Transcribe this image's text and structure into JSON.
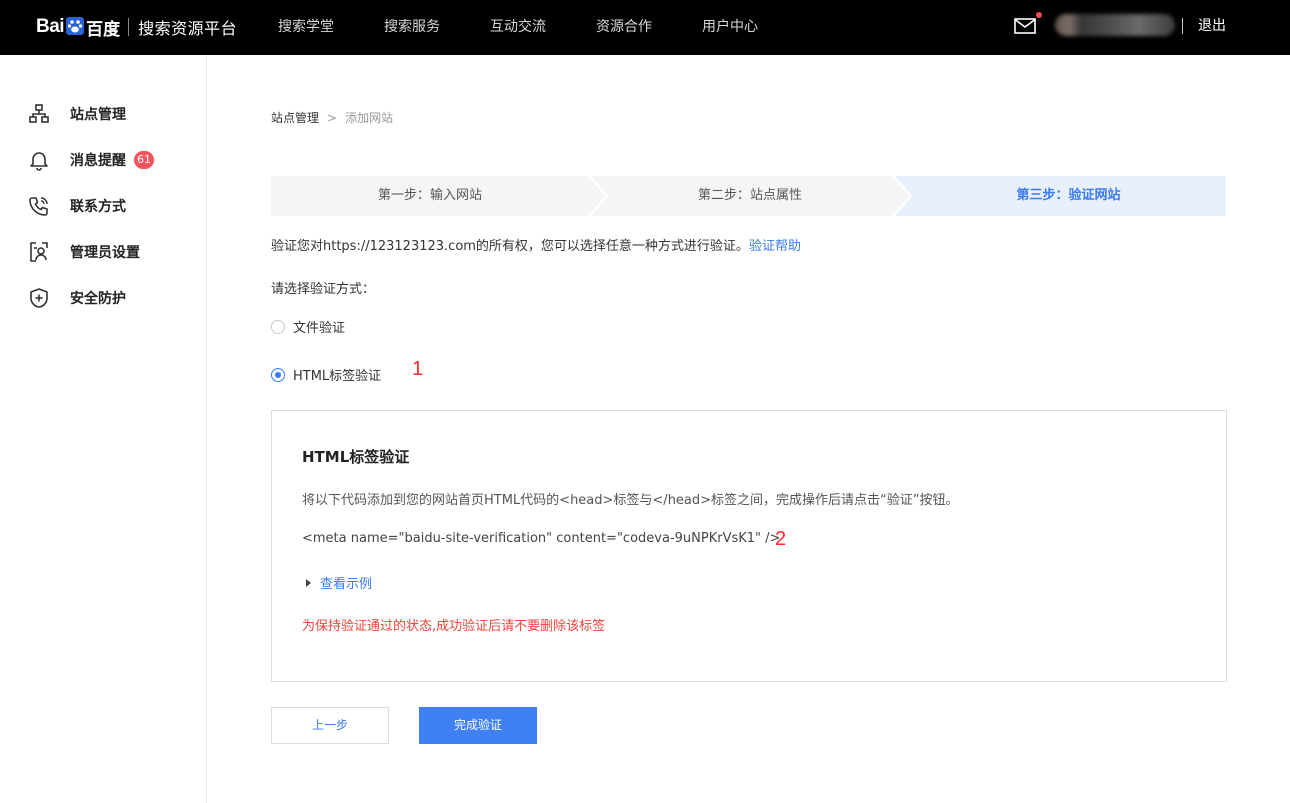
{
  "header": {
    "logo_text_left": "Bai",
    "logo_text_right": "百度",
    "platform_title": "搜索资源平台",
    "nav": [
      "搜索学堂",
      "搜索服务",
      "互动交流",
      "资源合作",
      "用户中心"
    ],
    "logout": "退出"
  },
  "sidebar": {
    "items": [
      {
        "label": "站点管理",
        "icon": "sitemap-icon"
      },
      {
        "label": "消息提醒",
        "icon": "bell-icon",
        "badge": "61"
      },
      {
        "label": "联系方式",
        "icon": "phone-icon"
      },
      {
        "label": "管理员设置",
        "icon": "admin-icon"
      },
      {
        "label": "安全防护",
        "icon": "shield-icon"
      }
    ]
  },
  "breadcrumb": {
    "parent": "站点管理",
    "separator": ">",
    "current": "添加网站"
  },
  "steps": [
    "第一步：输入网站",
    "第二步：站点属性",
    "第三步：验证网站"
  ],
  "verify": {
    "description": "验证您对https://123123123.com的所有权，您可以选择任意一种方式进行验证。",
    "help_link": "验证帮助",
    "choose_label": "请选择验证方式：",
    "options": [
      "文件验证",
      "HTML标签验证"
    ],
    "selected_option": "HTML标签验证"
  },
  "annotations": {
    "one": "1",
    "two": "2"
  },
  "panel": {
    "title": "HTML标签验证",
    "description": "将以下代码添加到您的网站首页HTML代码的<head>标签与</head>标签之间，完成操作后请点击“验证”按钮。",
    "meta_code": "<meta name=\"baidu-site-verification\" content=\"codeva-9uNPKrVsK1\" />",
    "example_label": "查看示例",
    "warning": "为保持验证通过的状态,成功验证后请不要删除该标签"
  },
  "buttons": {
    "prev": "上一步",
    "done": "完成验证"
  },
  "colors": {
    "accent": "#3a7bf0",
    "warning": "#f0443c",
    "badge": "#f5545c",
    "topbar": "#000000"
  }
}
